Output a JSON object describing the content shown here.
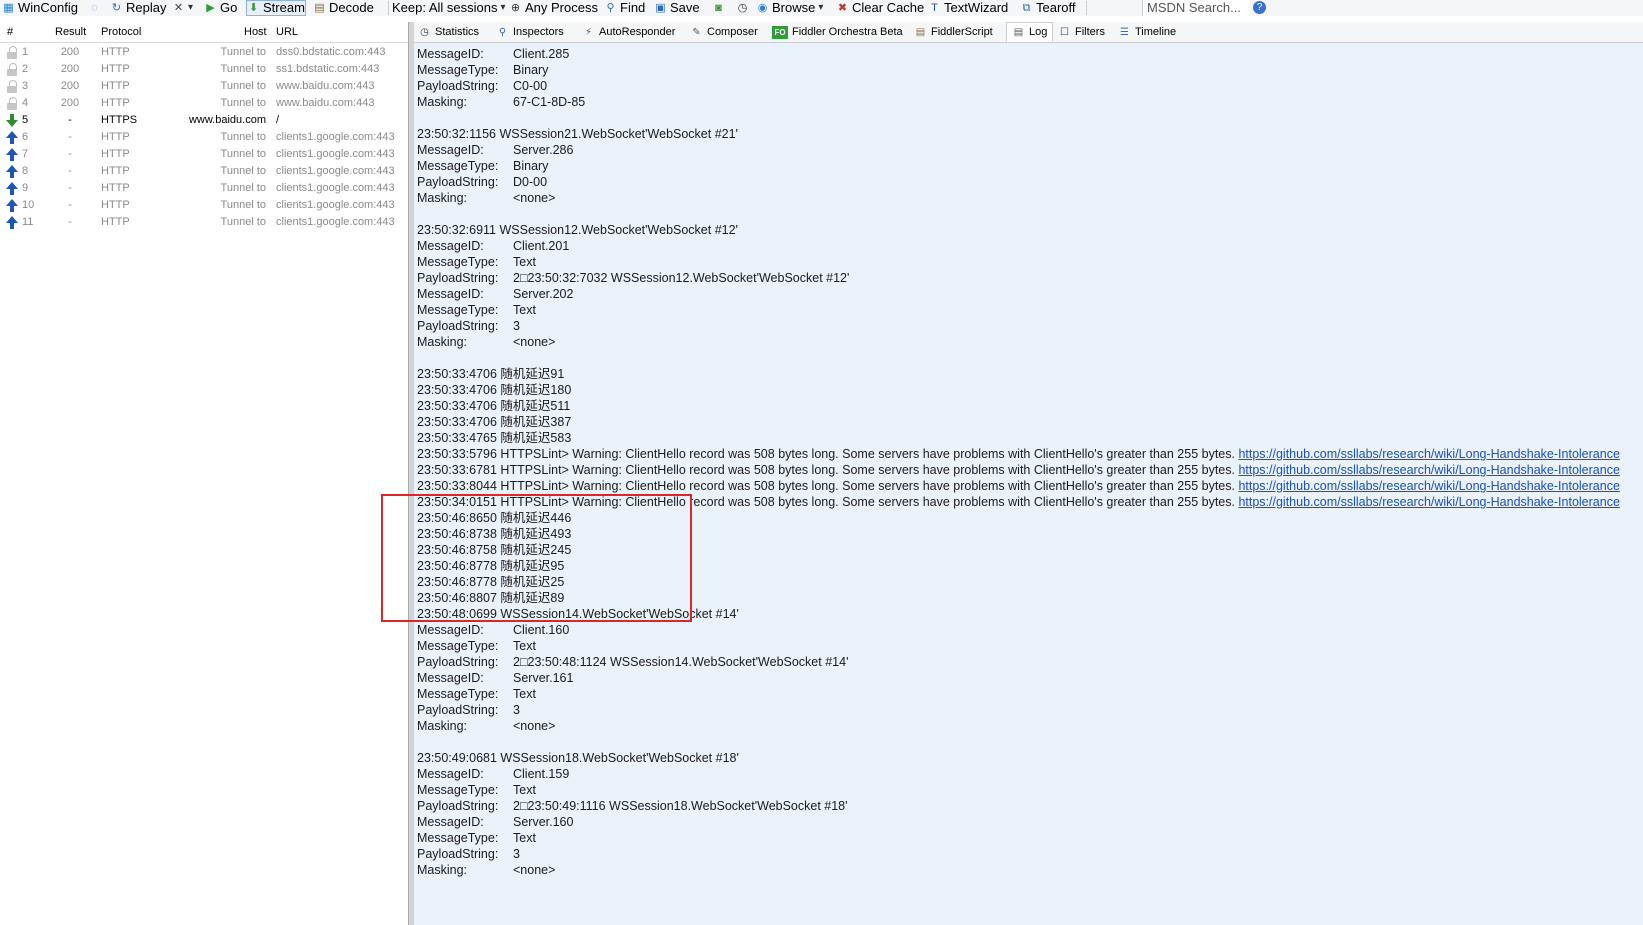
{
  "toolbar": {
    "items": [
      {
        "label": "WinConfig",
        "icon": "windows-icon"
      },
      {
        "label": "",
        "icon": "comment-icon"
      },
      {
        "label": "Replay",
        "icon": "replay-icon"
      },
      {
        "label": "",
        "icon": "remove-icon"
      },
      {
        "label": "Go",
        "icon": "go-icon"
      },
      {
        "label": "Stream",
        "icon": "stream-icon"
      },
      {
        "label": "Decode",
        "icon": "decode-icon"
      },
      {
        "label": "Keep: All sessions",
        "icon": "dropdown-icon"
      },
      {
        "label": "Any Process",
        "icon": "crosshair-icon"
      },
      {
        "label": "Find",
        "icon": "binoculars-icon"
      },
      {
        "label": "Save",
        "icon": "save-icon"
      },
      {
        "label": "",
        "icon": "camera-icon"
      },
      {
        "label": "",
        "icon": "timer-icon"
      },
      {
        "label": "Browse",
        "icon": "globe-icon"
      },
      {
        "label": "Clear Cache",
        "icon": "clear-cache-icon"
      },
      {
        "label": "TextWizard",
        "icon": "textwizard-icon"
      },
      {
        "label": "Tearoff",
        "icon": "tearoff-icon"
      }
    ],
    "search_placeholder": "MSDN Search...",
    "help_icon": "help-icon"
  },
  "sessions": {
    "columns": [
      "#",
      "Result",
      "Protocol",
      "Host",
      "URL"
    ],
    "rows": [
      {
        "num": "1",
        "result": "200",
        "protocol": "HTTP",
        "host": "Tunnel to",
        "url": "dss0.bdstatic.com:443",
        "icon": "lock-icon"
      },
      {
        "num": "2",
        "result": "200",
        "protocol": "HTTP",
        "host": "Tunnel to",
        "url": "ss1.bdstatic.com:443",
        "icon": "lock-icon"
      },
      {
        "num": "3",
        "result": "200",
        "protocol": "HTTP",
        "host": "Tunnel to",
        "url": "www.baidu.com:443",
        "icon": "lock-icon"
      },
      {
        "num": "4",
        "result": "200",
        "protocol": "HTTP",
        "host": "Tunnel to",
        "url": "www.baidu.com:443",
        "icon": "lock-icon"
      },
      {
        "num": "5",
        "result": "-",
        "protocol": "HTTPS",
        "host": "www.baidu.com",
        "url": "/",
        "icon": "download-arrow-icon"
      },
      {
        "num": "6",
        "result": "-",
        "protocol": "HTTP",
        "host": "Tunnel to",
        "url": "clients1.google.com:443",
        "icon": "upload-arrow-icon"
      },
      {
        "num": "7",
        "result": "-",
        "protocol": "HTTP",
        "host": "Tunnel to",
        "url": "clients1.google.com:443",
        "icon": "upload-arrow-icon"
      },
      {
        "num": "8",
        "result": "-",
        "protocol": "HTTP",
        "host": "Tunnel to",
        "url": "clients1.google.com:443",
        "icon": "upload-arrow-icon"
      },
      {
        "num": "9",
        "result": "-",
        "protocol": "HTTP",
        "host": "Tunnel to",
        "url": "clients1.google.com:443",
        "icon": "upload-arrow-icon"
      },
      {
        "num": "10",
        "result": "-",
        "protocol": "HTTP",
        "host": "Tunnel to",
        "url": "clients1.google.com:443",
        "icon": "upload-arrow-icon"
      },
      {
        "num": "11",
        "result": "-",
        "protocol": "HTTP",
        "host": "Tunnel to",
        "url": "clients1.google.com:443",
        "icon": "upload-arrow-icon"
      }
    ]
  },
  "tabs": [
    {
      "label": "Statistics",
      "icon": "statistics-icon"
    },
    {
      "label": "Inspectors",
      "icon": "inspectors-icon"
    },
    {
      "label": "AutoResponder",
      "icon": "lightning-icon"
    },
    {
      "label": "Composer",
      "icon": "composer-icon"
    },
    {
      "label": "Fiddler Orchestra Beta",
      "icon": "fo-icon"
    },
    {
      "label": "FiddlerScript",
      "icon": "script-icon"
    },
    {
      "label": "Log",
      "icon": "log-icon",
      "active": true
    },
    {
      "label": "Filters",
      "icon": "filter-checkbox-icon"
    },
    {
      "label": "Timeline",
      "icon": "timeline-icon"
    }
  ],
  "log": {
    "lines": [
      {
        "k": "MessageID:",
        "v": "Client.285"
      },
      {
        "k": "MessageType:",
        "v": "Binary"
      },
      {
        "k": "PayloadString:",
        "v": "C0-00"
      },
      {
        "k": "Masking:",
        "v": "67-C1-8D-85"
      },
      {
        "t": ""
      },
      {
        "t": "23:50:32:1156 WSSession21.WebSocket'WebSocket #21'"
      },
      {
        "k": "MessageID:",
        "v": "Server.286"
      },
      {
        "k": "MessageType:",
        "v": "Binary"
      },
      {
        "k": "PayloadString:",
        "v": "D0-00"
      },
      {
        "k": "Masking:",
        "v": "<none>"
      },
      {
        "t": ""
      },
      {
        "t": "23:50:32:6911 WSSession12.WebSocket'WebSocket #12'"
      },
      {
        "k": "MessageID:",
        "v": "Client.201"
      },
      {
        "k": "MessageType:",
        "v": "Text"
      },
      {
        "k": "PayloadString:",
        "v": "2□23:50:32:7032 WSSession12.WebSocket'WebSocket #12'"
      },
      {
        "k": "MessageID:",
        "v": "Server.202"
      },
      {
        "k": "MessageType:",
        "v": "Text"
      },
      {
        "k": "PayloadString:",
        "v": "3"
      },
      {
        "k": "Masking:",
        "v": "<none>"
      },
      {
        "t": ""
      },
      {
        "t": "23:50:33:4706 随机延迟91"
      },
      {
        "t": "23:50:33:4706 随机延迟180"
      },
      {
        "t": "23:50:33:4706 随机延迟511"
      },
      {
        "t": "23:50:33:4706 随机延迟387"
      },
      {
        "t": "23:50:33:4765 随机延迟583"
      },
      {
        "t": "23:50:33:5796 HTTPSLint> Warning: ClientHello record was 508 bytes long. Some servers have problems with ClientHello's greater than 255 bytes. ",
        "link": "https://github.com/ssllabs/research/wiki/Long-Handshake-Intolerance"
      },
      {
        "t": "23:50:33:6781 HTTPSLint> Warning: ClientHello record was 508 bytes long. Some servers have problems with ClientHello's greater than 255 bytes. ",
        "link": "https://github.com/ssllabs/research/wiki/Long-Handshake-Intolerance"
      },
      {
        "t": "23:50:33:8044 HTTPSLint> Warning: ClientHello record was 508 bytes long. Some servers have problems with ClientHello's greater than 255 bytes. ",
        "link": "https://github.com/ssllabs/research/wiki/Long-Handshake-Intolerance"
      },
      {
        "t": "23:50:34:0151 HTTPSLint> Warning: ClientHello record was 508 bytes long. Some servers have problems with ClientHello's greater than 255 bytes. ",
        "link": "https://github.com/ssllabs/research/wiki/Long-Handshake-Intolerance"
      },
      {
        "t": "23:50:46:8650 随机延迟446"
      },
      {
        "t": "23:50:46:8738 随机延迟493"
      },
      {
        "t": "23:50:46:8758 随机延迟245"
      },
      {
        "t": "23:50:46:8778 随机延迟95"
      },
      {
        "t": "23:50:46:8778 随机延迟25"
      },
      {
        "t": "23:50:46:8807 随机延迟89"
      },
      {
        "t": "23:50:48:0699 WSSession14.WebSocket'WebSocket #14'"
      },
      {
        "k": "MessageID:",
        "v": "Client.160"
      },
      {
        "k": "MessageType:",
        "v": "Text"
      },
      {
        "k": "PayloadString:",
        "v": "2□23:50:48:1124 WSSession14.WebSocket'WebSocket #14'"
      },
      {
        "k": "MessageID:",
        "v": "Server.161"
      },
      {
        "k": "MessageType:",
        "v": "Text"
      },
      {
        "k": "PayloadString:",
        "v": "3"
      },
      {
        "k": "Masking:",
        "v": "<none>"
      },
      {
        "t": ""
      },
      {
        "t": "23:50:49:0681 WSSession18.WebSocket'WebSocket #18'"
      },
      {
        "k": "MessageID:",
        "v": "Client.159"
      },
      {
        "k": "MessageType:",
        "v": "Text"
      },
      {
        "k": "PayloadString:",
        "v": "2□23:50:49:1116 WSSession18.WebSocket'WebSocket #18'"
      },
      {
        "k": "MessageID:",
        "v": "Server.160"
      },
      {
        "k": "MessageType:",
        "v": "Text"
      },
      {
        "k": "PayloadString:",
        "v": "3"
      },
      {
        "k": "Masking:",
        "v": "<none>"
      }
    ]
  },
  "colors": {
    "log_background": "#eaf2fb",
    "highlight_box": "#e0242a",
    "link": "#1b4fc2"
  }
}
